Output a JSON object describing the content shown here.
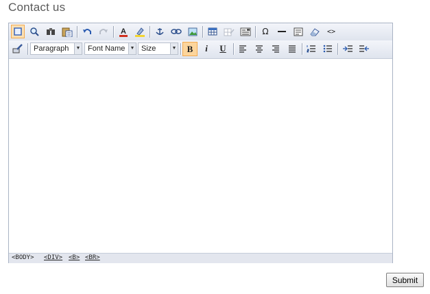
{
  "page": {
    "title": "Contact us"
  },
  "toolbar_top": [
    {
      "name": "select-all-icon",
      "glyph": "▢",
      "state": "active"
    },
    {
      "name": "find-icon",
      "glyph": "🔍"
    },
    {
      "name": "find-replace-icon",
      "glyph": "⚲"
    },
    {
      "name": "paste-icon",
      "glyph": "📋"
    },
    {
      "name": "undo-icon",
      "glyph": "↶"
    },
    {
      "name": "redo-icon",
      "glyph": "↷",
      "state": "disabled"
    },
    {
      "name": "font-color-icon",
      "glyph": "A"
    },
    {
      "name": "highlight-icon",
      "glyph": "✎"
    },
    {
      "name": "anchor-icon",
      "glyph": "⚓"
    },
    {
      "name": "link-icon",
      "glyph": "∞"
    },
    {
      "name": "image-icon",
      "glyph": "▣"
    },
    {
      "name": "table-icon",
      "glyph": "▦"
    },
    {
      "name": "table-edit-icon",
      "glyph": "▤",
      "state": "disabled"
    },
    {
      "name": "form-icon",
      "glyph": "☰"
    },
    {
      "name": "special-char-icon",
      "glyph": "Ω"
    },
    {
      "name": "horizontal-rule-icon",
      "glyph": "—"
    },
    {
      "name": "page-properties-icon",
      "glyph": "▥"
    },
    {
      "name": "clean-format-icon",
      "glyph": "◇"
    },
    {
      "name": "html-source-icon",
      "glyph": "<>"
    }
  ],
  "toolbar_bottom": {
    "format_painter_icon": "format-painter-icon",
    "paragraph_select": "Paragraph",
    "font_select": "Font Name",
    "size_select": "Size",
    "bold": "B",
    "italic": "i",
    "underline": "U",
    "buttons": [
      {
        "name": "align-left-icon"
      },
      {
        "name": "align-center-icon"
      },
      {
        "name": "align-right-icon"
      },
      {
        "name": "justify-icon"
      },
      {
        "name": "ordered-list-icon"
      },
      {
        "name": "unordered-list-icon"
      },
      {
        "name": "indent-icon"
      },
      {
        "name": "outdent-icon"
      }
    ]
  },
  "statusbar": {
    "tags": [
      "<BODY>",
      "<DIV>",
      "<B>",
      "<BR>"
    ]
  },
  "submit": {
    "label": "Submit"
  }
}
